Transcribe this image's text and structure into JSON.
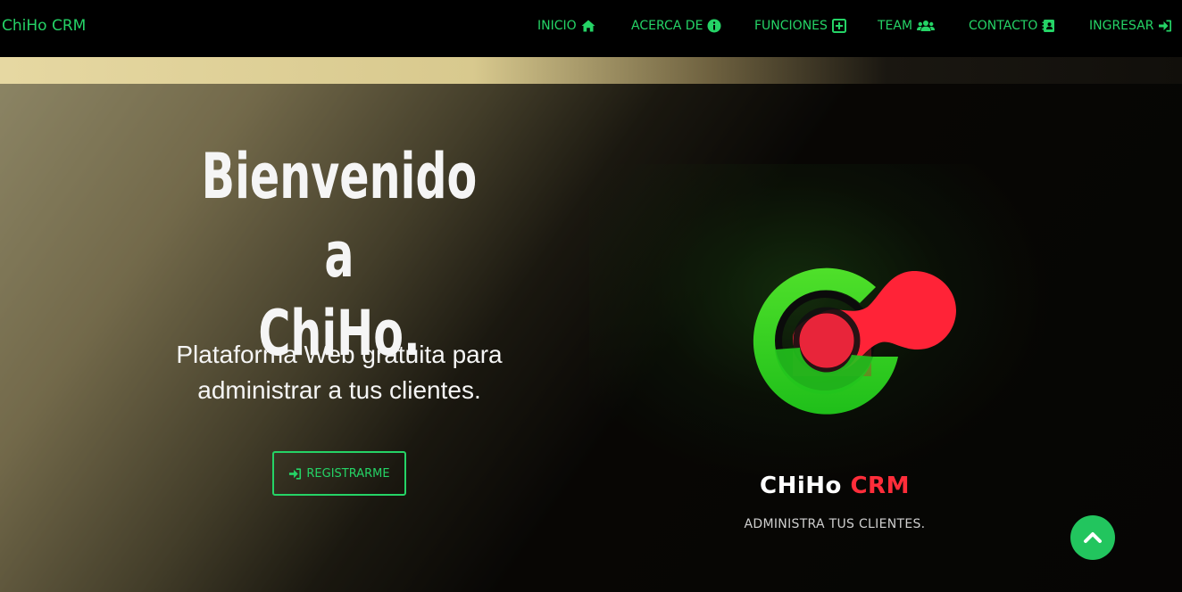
{
  "navbar": {
    "brand": "ChiHo CRM",
    "items": [
      {
        "label": "INICIO",
        "icon": "home-icon"
      },
      {
        "label": "ACERCA DE",
        "icon": "info-circle-icon"
      },
      {
        "label": "FUNCIONES",
        "icon": "plus-square-icon"
      },
      {
        "label": "TEAM",
        "icon": "users-icon"
      },
      {
        "label": "CONTACTO",
        "icon": "address-book-icon"
      },
      {
        "label": "INGRESAR",
        "icon": "sign-in-icon"
      }
    ]
  },
  "hero": {
    "title_line1": "Bienvenido a",
    "title_line2": "ChiHo.",
    "subtitle_line1": "Plataforma Web gratuita para",
    "subtitle_line2": "administrar a tus clientes.",
    "register_label": "REGISTRARME"
  },
  "logo": {
    "word_main": "CHiHo",
    "word_accent": "CRM",
    "tagline": "ADMINISTRA TUS CLIENTES."
  },
  "colors": {
    "accent": "#25d366",
    "logo_green": "#33d41f",
    "logo_red": "#ff2d3a",
    "navbar_bg": "#000000"
  }
}
